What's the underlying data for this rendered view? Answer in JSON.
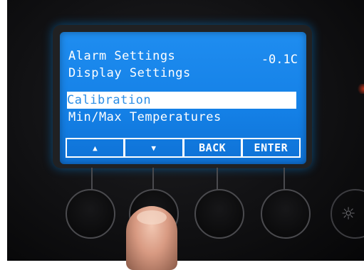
{
  "display": {
    "temperature": "-0.1C",
    "menu_items": [
      {
        "label": "Alarm Settings",
        "selected": false
      },
      {
        "label": "Display Settings",
        "selected": false
      },
      {
        "label": "Calibration",
        "selected": true
      },
      {
        "label": "Min/Max Temperatures",
        "selected": false
      }
    ],
    "softkeys": [
      {
        "label": "▲"
      },
      {
        "label": "▼"
      },
      {
        "label": "BACK"
      },
      {
        "label": "ENTER"
      }
    ]
  },
  "physical_buttons": [
    "up-button",
    "down-button",
    "back-button",
    "enter-button",
    "backlight-button"
  ],
  "colors": {
    "lcd_blue": "#1585ea",
    "lcd_text": "#ffffff",
    "selection_text": "#2a8de6",
    "panel": "#151517"
  },
  "icons": {
    "backlight": "sun-icon"
  }
}
